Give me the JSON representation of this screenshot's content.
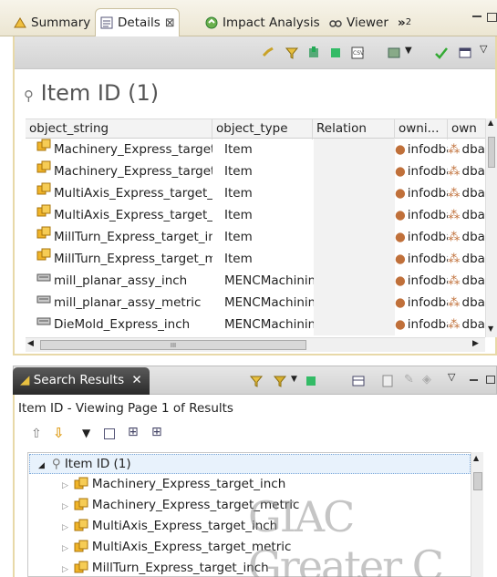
{
  "tabs": {
    "summary": "Summary",
    "details": "Details",
    "impact": "Impact Analysis",
    "viewer": "Viewer",
    "overflow": "»",
    "overflow_count": "2"
  },
  "details": {
    "title": "Item ID (1)",
    "columns": [
      "object_string",
      "object_type",
      "Relation",
      "owni...",
      "own"
    ],
    "rows": [
      {
        "name": "Machinery_Express_target_inch",
        "type": "Item",
        "owner": "infodba",
        "group": "dba",
        "icon": "item-icon"
      },
      {
        "name": "Machinery_Express_target_metric",
        "type": "Item",
        "owner": "infodba",
        "group": "dba",
        "icon": "item-icon"
      },
      {
        "name": "MultiAxis_Express_target_inch",
        "type": "Item",
        "owner": "infodba",
        "group": "dba",
        "icon": "item-icon"
      },
      {
        "name": "MultiAxis_Express_target_metric",
        "type": "Item",
        "owner": "infodba",
        "group": "dba",
        "icon": "item-icon"
      },
      {
        "name": "MillTurn_Express_target_inch",
        "type": "Item",
        "owner": "infodba",
        "group": "dba",
        "icon": "item-icon"
      },
      {
        "name": "MillTurn_Express_target_metric",
        "type": "Item",
        "owner": "infodba",
        "group": "dba",
        "icon": "item-icon"
      },
      {
        "name": "mill_planar_assy_inch",
        "type": "MENCMachining",
        "owner": "infodba",
        "group": "dba",
        "icon": "machining-icon"
      },
      {
        "name": "mill_planar_assy_metric",
        "type": "MENCMachining",
        "owner": "infodba",
        "group": "dba",
        "icon": "machining-icon"
      },
      {
        "name": "DieMold_Express_inch",
        "type": "MENCMachining",
        "owner": "infodba",
        "group": "dba",
        "icon": "machining-icon"
      }
    ],
    "hscroll_grip": "III"
  },
  "search": {
    "tab_label": "Search Results",
    "close": "✕",
    "header": "Item ID - Viewing Page 1 of Results",
    "root": "Item ID (1)",
    "items": [
      "Machinery_Express_target_inch",
      "Machinery_Express_target_metric",
      "MultiAxis_Express_target_inch",
      "MultiAxis_Express_target_metric",
      "MillTurn_Express_target_inch"
    ]
  },
  "watermark": "GIAC Greater C",
  "colors": {
    "accent": "#e8d9a8",
    "item_icon": "#e8a820",
    "owner_icon": "#d2691e"
  }
}
